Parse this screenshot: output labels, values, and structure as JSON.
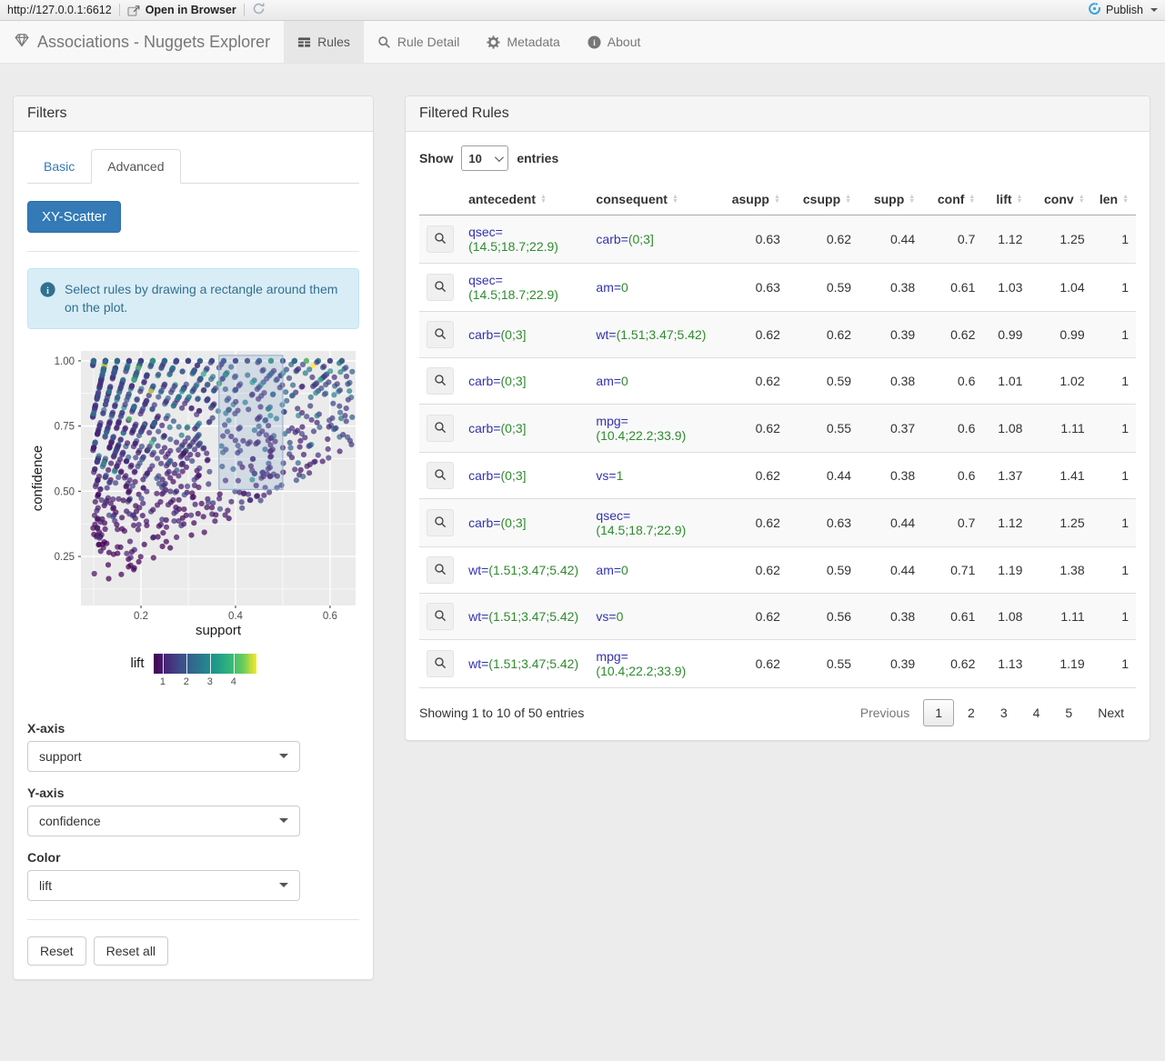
{
  "viewer_toolbar": {
    "url": "http://127.0.0.1:6612",
    "open_in_browser": "Open in Browser",
    "publish_label": "Publish"
  },
  "navbar": {
    "brand": "Associations - Nuggets Explorer",
    "tabs": [
      {
        "label": "Rules",
        "icon": "table-icon",
        "active": true
      },
      {
        "label": "Rule Detail",
        "icon": "search-icon",
        "active": false
      },
      {
        "label": "Metadata",
        "icon": "gear-icon",
        "active": false
      },
      {
        "label": "About",
        "icon": "info-icon",
        "active": false
      }
    ]
  },
  "filters": {
    "title": "Filters",
    "tabs": [
      {
        "label": "Basic",
        "active": false
      },
      {
        "label": "Advanced",
        "active": true
      }
    ],
    "scatter_button": "XY-Scatter",
    "info_alert": "Select rules by drawing a rectangle around them on the plot.",
    "controls": [
      {
        "label": "X-axis",
        "value": "support"
      },
      {
        "label": "Y-axis",
        "value": "confidence"
      },
      {
        "label": "Color",
        "value": "lift"
      }
    ],
    "reset_button": "Reset",
    "reset_all_button": "Reset all"
  },
  "chart_data": {
    "type": "scatter",
    "xlabel": "support",
    "ylabel": "confidence",
    "xlim": [
      0.073,
      0.654
    ],
    "ylim": [
      0.062,
      1.038
    ],
    "x_ticks": [
      0.2,
      0.4,
      0.6
    ],
    "y_ticks": [
      0.25,
      0.5,
      0.75,
      1.0
    ],
    "y_tick_labels": [
      "0.25",
      "0.50",
      "0.75",
      "1.00"
    ],
    "x_tick_labels": [
      "0.2",
      "0.4",
      "0.6"
    ],
    "grid": true,
    "panel_color": "#EBEBEB",
    "selection_brush": {
      "x": [
        0.365,
        0.5
      ],
      "y": [
        0.507,
        1.021
      ]
    },
    "legend": {
      "title": "lift",
      "ticks": [
        1,
        2,
        3,
        4
      ],
      "range": [
        0.6,
        4.95
      ],
      "position": "bottom"
    },
    "colormap": {
      "name": "viridis",
      "stops": [
        "#440154",
        "#482878",
        "#3e4a89",
        "#31688e",
        "#26828e",
        "#1f9e89",
        "#35b779",
        "#6ece58",
        "#fde725"
      ],
      "lift_domain": [
        0.4,
        4.6
      ]
    },
    "points_spec": {
      "comment": "dense wedge of ~1150 rules: conf = supp/asupp with quantized asupp producing diagonal rays; supp in [0.098,0.648]; conf skewed high with a band at 1.0; color = lift",
      "seed": 20,
      "n": 1150,
      "a_min": 0.1,
      "a_span": 0.9,
      "a_pow": 2.2,
      "a_quant": 0.025,
      "conf_base": 0.13,
      "conf_span": 0.87,
      "conf_pow": 0.55,
      "conf_top_frac": 0.07,
      "supp_min": 0.098,
      "supp_max": 0.648,
      "q_min": 0.3,
      "q_span": 0.65,
      "q_quant": 0.05,
      "q_low_frac": 0.02,
      "lift_cap": 4.8
    }
  },
  "table_panel": {
    "title": "Filtered Rules",
    "show_label": "Show",
    "page_length": "10",
    "entries_label": "entries",
    "columns": [
      "antecedent",
      "consequent",
      "asupp",
      "csupp",
      "supp",
      "conf",
      "lift",
      "conv",
      "len"
    ],
    "rows": [
      {
        "antecedent": {
          "attr": "qsec=",
          "value": "(14.5;18.7;22.9)"
        },
        "consequent": {
          "attr": "carb=",
          "value": "(0;3]"
        },
        "asupp": "0.63",
        "csupp": "0.62",
        "supp": "0.44",
        "conf": "0.7",
        "lift": "1.12",
        "conv": "1.25",
        "len": "1"
      },
      {
        "antecedent": {
          "attr": "qsec=",
          "value": "(14.5;18.7;22.9)"
        },
        "consequent": {
          "attr": "am=",
          "value": "0"
        },
        "asupp": "0.63",
        "csupp": "0.59",
        "supp": "0.38",
        "conf": "0.61",
        "lift": "1.03",
        "conv": "1.04",
        "len": "1"
      },
      {
        "antecedent": {
          "attr": "carb=",
          "value": "(0;3]"
        },
        "consequent": {
          "attr": "wt=",
          "value": "(1.51;3.47;5.42)"
        },
        "asupp": "0.62",
        "csupp": "0.62",
        "supp": "0.39",
        "conf": "0.62",
        "lift": "0.99",
        "conv": "0.99",
        "len": "1"
      },
      {
        "antecedent": {
          "attr": "carb=",
          "value": "(0;3]"
        },
        "consequent": {
          "attr": "am=",
          "value": "0"
        },
        "asupp": "0.62",
        "csupp": "0.59",
        "supp": "0.38",
        "conf": "0.6",
        "lift": "1.01",
        "conv": "1.02",
        "len": "1"
      },
      {
        "antecedent": {
          "attr": "carb=",
          "value": "(0;3]"
        },
        "consequent": {
          "attr": "mpg=",
          "value": "(10.4;22.2;33.9)"
        },
        "asupp": "0.62",
        "csupp": "0.55",
        "supp": "0.37",
        "conf": "0.6",
        "lift": "1.08",
        "conv": "1.11",
        "len": "1"
      },
      {
        "antecedent": {
          "attr": "carb=",
          "value": "(0;3]"
        },
        "consequent": {
          "attr": "vs=",
          "value": "1"
        },
        "asupp": "0.62",
        "csupp": "0.44",
        "supp": "0.38",
        "conf": "0.6",
        "lift": "1.37",
        "conv": "1.41",
        "len": "1"
      },
      {
        "antecedent": {
          "attr": "carb=",
          "value": "(0;3]"
        },
        "consequent": {
          "attr": "qsec=",
          "value": "(14.5;18.7;22.9)"
        },
        "asupp": "0.62",
        "csupp": "0.63",
        "supp": "0.44",
        "conf": "0.7",
        "lift": "1.12",
        "conv": "1.25",
        "len": "1"
      },
      {
        "antecedent": {
          "attr": "wt=",
          "value": "(1.51;3.47;5.42)"
        },
        "consequent": {
          "attr": "am=",
          "value": "0"
        },
        "asupp": "0.62",
        "csupp": "0.59",
        "supp": "0.44",
        "conf": "0.71",
        "lift": "1.19",
        "conv": "1.38",
        "len": "1"
      },
      {
        "antecedent": {
          "attr": "wt=",
          "value": "(1.51;3.47;5.42)"
        },
        "consequent": {
          "attr": "vs=",
          "value": "0"
        },
        "asupp": "0.62",
        "csupp": "0.56",
        "supp": "0.38",
        "conf": "0.61",
        "lift": "1.08",
        "conv": "1.11",
        "len": "1"
      },
      {
        "antecedent": {
          "attr": "wt=",
          "value": "(1.51;3.47;5.42)"
        },
        "consequent": {
          "attr": "mpg=",
          "value": "(10.4;22.2;33.9)"
        },
        "asupp": "0.62",
        "csupp": "0.55",
        "supp": "0.39",
        "conf": "0.62",
        "lift": "1.13",
        "conv": "1.19",
        "len": "1"
      }
    ],
    "info": "Showing 1 to 10 of 50 entries",
    "pagination": {
      "previous": "Previous",
      "pages": [
        "1",
        "2",
        "3",
        "4",
        "5"
      ],
      "current_page": "1",
      "next": "Next"
    }
  },
  "colors": {
    "accent": "#337ab7",
    "attr_text": "#3232b0",
    "value_text": "#2e8b2e",
    "alert_bg": "#d9edf7",
    "alert_text": "#31708f",
    "panel_header_bg": "#f5f5f5",
    "active_tab_bg": "#e7e7e7",
    "publish_icon_blue": "#3aa3dc"
  }
}
